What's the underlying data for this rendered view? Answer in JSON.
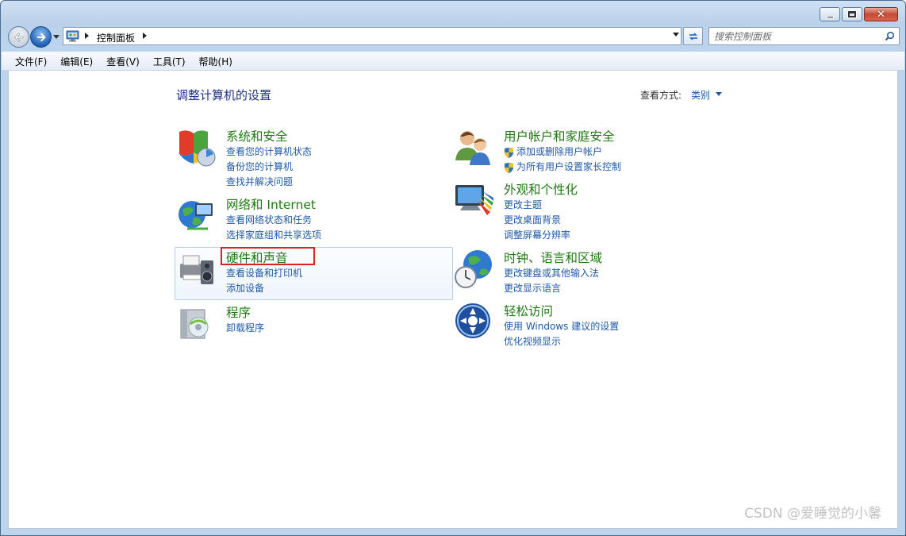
{
  "window": {
    "caption_buttons": [
      "minimize",
      "maximize",
      "close"
    ]
  },
  "nav": {
    "back_icon": "back-arrow-icon",
    "forward_icon": "forward-arrow-icon",
    "address_path": "控制面板",
    "search_placeholder": "搜索控制面板"
  },
  "menu": {
    "file": "文件(F)",
    "edit": "编辑(E)",
    "view": "查看(V)",
    "tools": "工具(T)",
    "help": "帮助(H)"
  },
  "main": {
    "title": "调整计算机的设置",
    "view_by_label": "查看方式:",
    "view_by_value": "类别"
  },
  "categories": {
    "system_security": {
      "heading": "系统和安全",
      "links": [
        "查看您的计算机状态",
        "备份您的计算机",
        "查找并解决问题"
      ]
    },
    "network": {
      "heading": "网络和 Internet",
      "links": [
        "查看网络状态和任务",
        "选择家庭组和共享选项"
      ]
    },
    "hardware_sound": {
      "heading": "硬件和声音",
      "links": [
        "查看设备和打印机",
        "添加设备"
      ]
    },
    "programs": {
      "heading": "程序",
      "links": [
        "卸载程序"
      ]
    },
    "user_accounts": {
      "heading": "用户帐户和家庭安全",
      "links": [
        "添加或删除用户帐户",
        "为所有用户设置家长控制"
      ]
    },
    "appearance": {
      "heading": "外观和个性化",
      "links": [
        "更改主题",
        "更改桌面背景",
        "调整屏幕分辨率"
      ]
    },
    "clock_region": {
      "heading": "时钟、语言和区域",
      "links": [
        "更改键盘或其他输入法",
        "更改显示语言"
      ]
    },
    "ease_of_access": {
      "heading": "轻松访问",
      "links": [
        "使用 Windows 建议的设置",
        "优化视频显示"
      ]
    }
  },
  "watermark": "CSDN @爱睡觉的小馨",
  "colors": {
    "heading": "#1f7a12",
    "link": "#1e5aa8",
    "title": "#1e3287",
    "highlight_box": "#e02020"
  }
}
